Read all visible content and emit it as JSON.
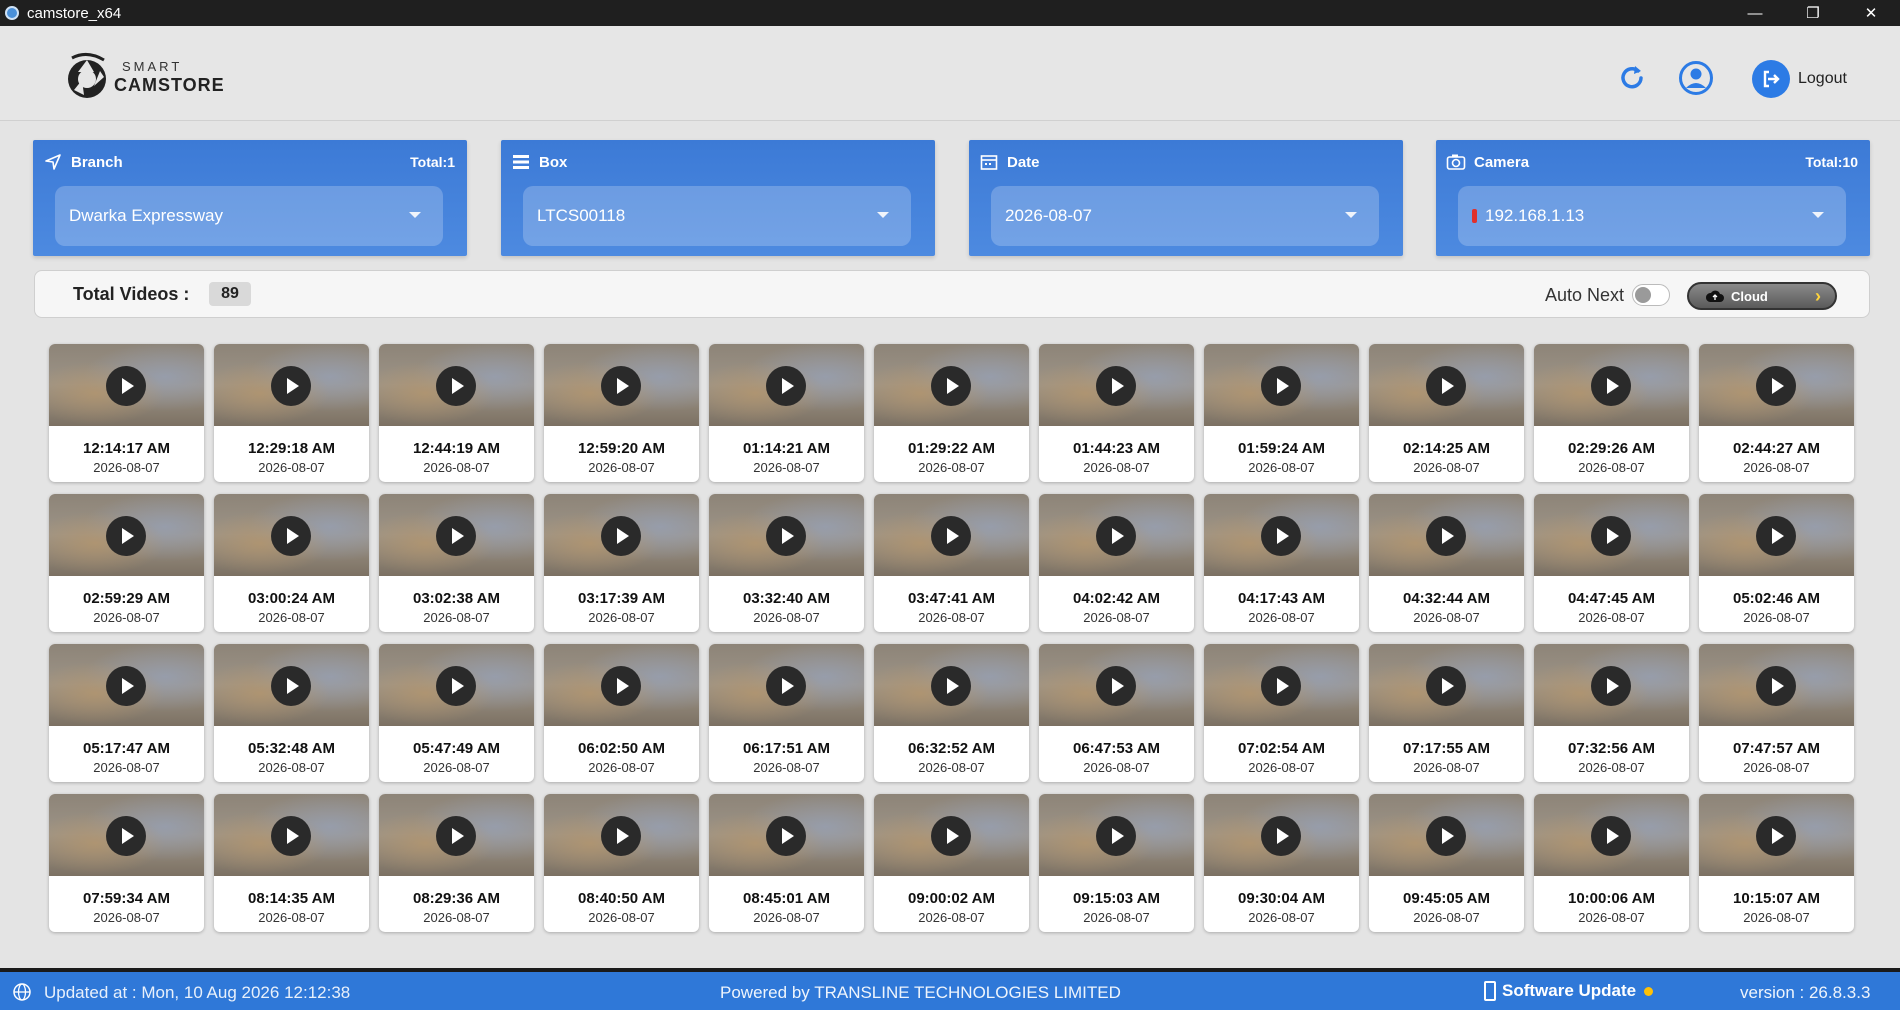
{
  "window": {
    "title": "camstore_x64",
    "controls": [
      "—",
      "❐",
      "✕"
    ]
  },
  "header": {
    "logo_small": "SMART",
    "logo_big": "CAMSTORE",
    "logout_label": "Logout"
  },
  "filters": [
    {
      "title": "Branch",
      "total": "Total:1",
      "value": "Dwarka Expressway",
      "icon": "navigation-arrow-icon"
    },
    {
      "title": "Box",
      "total": "",
      "value": "LTCS00118",
      "icon": "list-icon"
    },
    {
      "title": "Date",
      "total": "",
      "value": "2026-08-07",
      "icon": "calendar-icon"
    },
    {
      "title": "Camera",
      "total": "Total:10",
      "value": "192.168.1.13",
      "icon": "camera-icon"
    }
  ],
  "videos_bar": {
    "label": "Total Videos :",
    "count": "89",
    "auto_next_label": "Auto Next",
    "auto_next_on": false,
    "cloud_label": "Cloud"
  },
  "videos": [
    {
      "time": "12:14:17 AM",
      "date": "2026-08-07"
    },
    {
      "time": "12:29:18 AM",
      "date": "2026-08-07"
    },
    {
      "time": "12:44:19 AM",
      "date": "2026-08-07"
    },
    {
      "time": "12:59:20 AM",
      "date": "2026-08-07"
    },
    {
      "time": "01:14:21 AM",
      "date": "2026-08-07"
    },
    {
      "time": "01:29:22 AM",
      "date": "2026-08-07"
    },
    {
      "time": "01:44:23 AM",
      "date": "2026-08-07"
    },
    {
      "time": "01:59:24 AM",
      "date": "2026-08-07"
    },
    {
      "time": "02:14:25 AM",
      "date": "2026-08-07"
    },
    {
      "time": "02:29:26 AM",
      "date": "2026-08-07"
    },
    {
      "time": "02:44:27 AM",
      "date": "2026-08-07"
    },
    {
      "time": "02:59:29 AM",
      "date": "2026-08-07"
    },
    {
      "time": "03:00:24 AM",
      "date": "2026-08-07"
    },
    {
      "time": "03:02:38 AM",
      "date": "2026-08-07"
    },
    {
      "time": "03:17:39 AM",
      "date": "2026-08-07"
    },
    {
      "time": "03:32:40 AM",
      "date": "2026-08-07"
    },
    {
      "time": "03:47:41 AM",
      "date": "2026-08-07"
    },
    {
      "time": "04:02:42 AM",
      "date": "2026-08-07"
    },
    {
      "time": "04:17:43 AM",
      "date": "2026-08-07"
    },
    {
      "time": "04:32:44 AM",
      "date": "2026-08-07"
    },
    {
      "time": "04:47:45 AM",
      "date": "2026-08-07"
    },
    {
      "time": "05:02:46 AM",
      "date": "2026-08-07"
    },
    {
      "time": "05:17:47 AM",
      "date": "2026-08-07"
    },
    {
      "time": "05:32:48 AM",
      "date": "2026-08-07"
    },
    {
      "time": "05:47:49 AM",
      "date": "2026-08-07"
    },
    {
      "time": "06:02:50 AM",
      "date": "2026-08-07"
    },
    {
      "time": "06:17:51 AM",
      "date": "2026-08-07"
    },
    {
      "time": "06:32:52 AM",
      "date": "2026-08-07"
    },
    {
      "time": "06:47:53 AM",
      "date": "2026-08-07"
    },
    {
      "time": "07:02:54 AM",
      "date": "2026-08-07"
    },
    {
      "time": "07:17:55 AM",
      "date": "2026-08-07"
    },
    {
      "time": "07:32:56 AM",
      "date": "2026-08-07"
    },
    {
      "time": "07:47:57 AM",
      "date": "2026-08-07"
    },
    {
      "time": "07:59:34 AM",
      "date": "2026-08-07"
    },
    {
      "time": "08:14:35 AM",
      "date": "2026-08-07"
    },
    {
      "time": "08:29:36 AM",
      "date": "2026-08-07"
    },
    {
      "time": "08:40:50 AM",
      "date": "2026-08-07"
    },
    {
      "time": "08:45:01 AM",
      "date": "2026-08-07"
    },
    {
      "time": "09:00:02 AM",
      "date": "2026-08-07"
    },
    {
      "time": "09:15:03 AM",
      "date": "2026-08-07"
    },
    {
      "time": "09:30:04 AM",
      "date": "2026-08-07"
    },
    {
      "time": "09:45:05 AM",
      "date": "2026-08-07"
    },
    {
      "time": "10:00:06 AM",
      "date": "2026-08-07"
    },
    {
      "time": "10:15:07 AM",
      "date": "2026-08-07"
    }
  ],
  "statusbar": {
    "updated": "Updated at : Mon, 10 Aug 2026 12:12:38",
    "powered": "Powered by TRANSLINE TECHNOLOGIES LIMITED",
    "software_update": "Software Update",
    "version": "version   : 26.8.3.3"
  },
  "colors": {
    "accent": "#2c7be5",
    "filter_card": "#3c7ad6",
    "statusbar": "#2f78d8",
    "update_dot": "#ffc107",
    "camera_status": "#e0302b"
  }
}
